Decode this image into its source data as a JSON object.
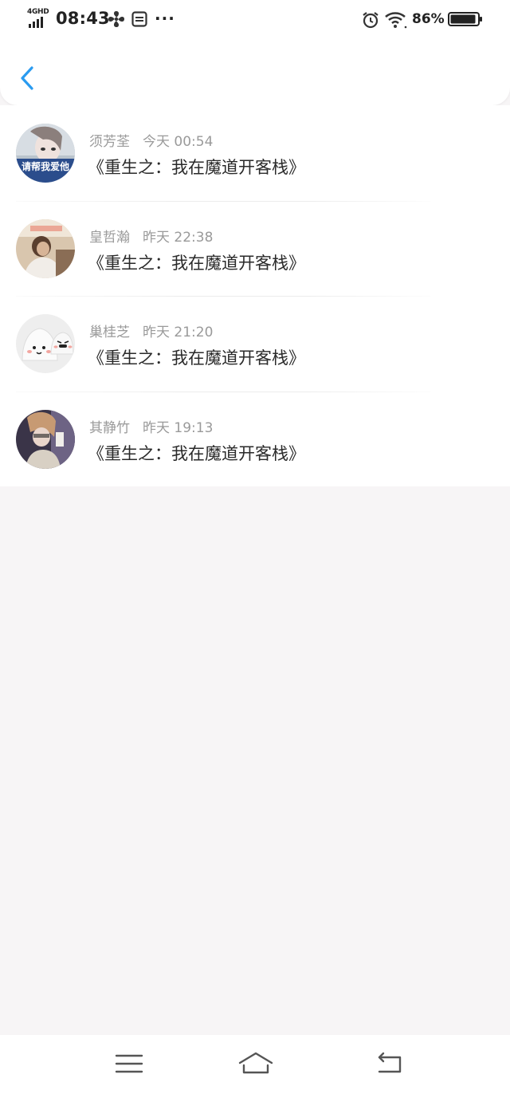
{
  "status_bar": {
    "network": "4GHD",
    "time": "08:43",
    "more": "···",
    "battery": "86%"
  },
  "header": {
    "back_icon": "chevron-left-icon",
    "accent": "#2a9bf0"
  },
  "messages": [
    {
      "name": "须芳荃",
      "time": "今天 00:54",
      "text": "《重生之：我在魔道开客栈》",
      "avatar_caption": "请帮我爱他"
    },
    {
      "name": "皇哲瀚",
      "time": "昨天 22:38",
      "text": "《重生之：我在魔道开客栈》",
      "avatar_caption": ""
    },
    {
      "name": "巢桂芝",
      "time": "昨天 21:20",
      "text": "《重生之：我在魔道开客栈》",
      "avatar_caption": ""
    },
    {
      "name": "其静竹",
      "time": "昨天 19:13",
      "text": "《重生之：我在魔道开客栈》",
      "avatar_caption": ""
    }
  ],
  "nav": {
    "menu_icon": "menu-icon",
    "home_icon": "home-icon",
    "back_icon": "back-icon"
  }
}
